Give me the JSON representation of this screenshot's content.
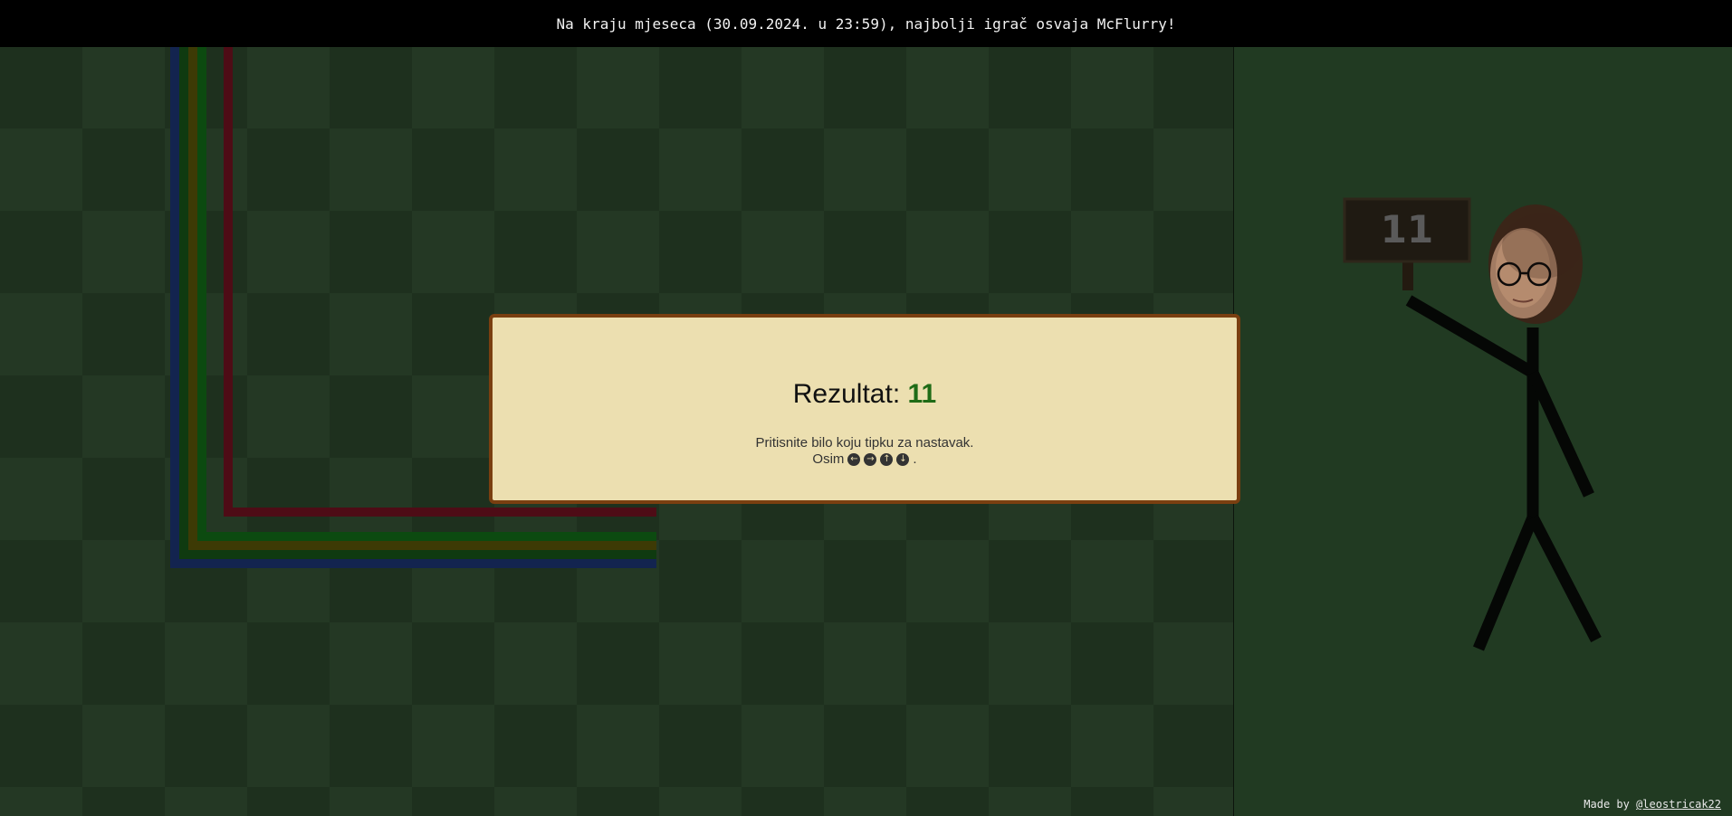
{
  "banner": {
    "text": "Na kraju mjeseca (30.09.2024. u 23:59), najbolji igrač osvaja McFlurry!"
  },
  "modal": {
    "score_label": "Rezultat: ",
    "score_value": "11",
    "hint": "Pritisnite bilo koju tipku za nastavak.",
    "except_label": "Osim",
    "except_end": ".",
    "arrow_keys": [
      "left-arrow-icon",
      "right-arrow-icon",
      "up-arrow-icon",
      "down-arrow-icon"
    ]
  },
  "sign": {
    "score": "11"
  },
  "footer": {
    "made_by": "Made by ",
    "author": "@leostricak22"
  },
  "colors": {
    "snake": [
      "#13244f",
      "#0f3a10",
      "#3d3a05",
      "#0c4a10",
      "#4e0c16"
    ],
    "score": "#1f6b16",
    "modal_bg": "#ecdfb0",
    "modal_border": "#7a3f10"
  }
}
